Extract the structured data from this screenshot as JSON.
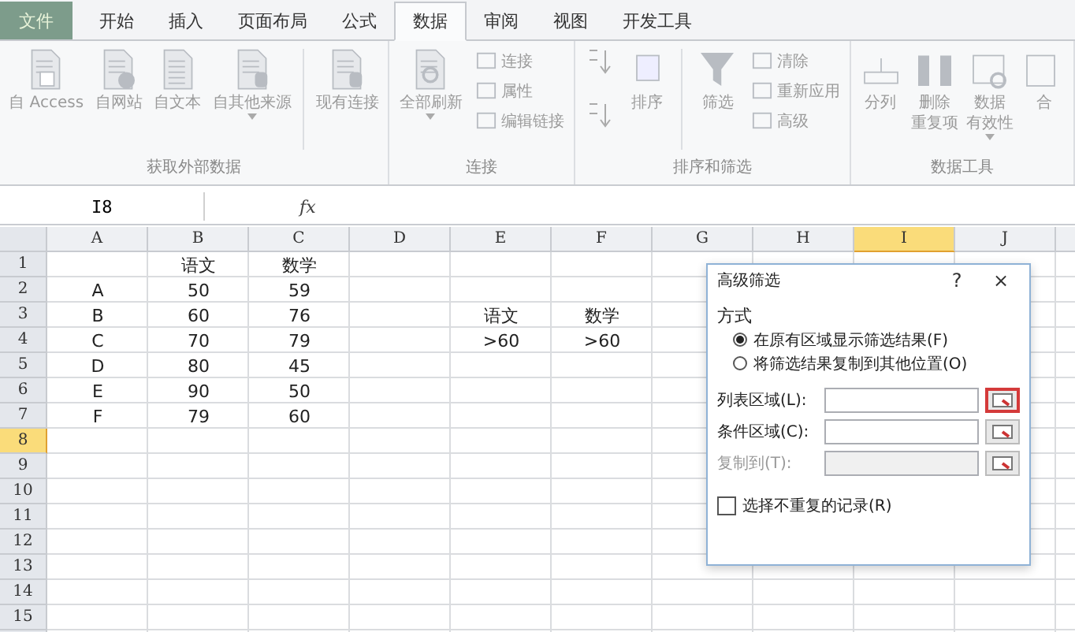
{
  "tabs": [
    {
      "label": "文件",
      "kind": "file",
      "selected": false
    },
    {
      "label": "开始",
      "kind": "tab",
      "selected": false
    },
    {
      "label": "插入",
      "kind": "tab",
      "selected": false
    },
    {
      "label": "页面布局",
      "kind": "tab",
      "selected": false
    },
    {
      "label": "公式",
      "kind": "tab",
      "selected": false
    },
    {
      "label": "数据",
      "kind": "tab",
      "selected": true
    },
    {
      "label": "审阅",
      "kind": "tab",
      "selected": false
    },
    {
      "label": "视图",
      "kind": "tab",
      "selected": false
    },
    {
      "label": "开发工具",
      "kind": "tab",
      "selected": false
    }
  ],
  "ribbon": {
    "disabled": true,
    "groups": [
      {
        "label": "获取外部数据",
        "items": [
          {
            "kind": "large",
            "lines": [
              "自 Access"
            ]
          },
          {
            "kind": "large",
            "lines": [
              "自网站"
            ]
          },
          {
            "kind": "large",
            "lines": [
              "自文本"
            ]
          },
          {
            "kind": "large",
            "lines": [
              "自其他来源"
            ],
            "dropdown": true
          },
          {
            "kind": "separator"
          },
          {
            "kind": "large",
            "lines": [
              "现有连接"
            ]
          }
        ]
      },
      {
        "label": "连接",
        "items": [
          {
            "kind": "large",
            "lines": [
              "全部刷新"
            ],
            "dropdown": true
          },
          {
            "kind": "stack",
            "buttons": [
              {
                "label": "连接"
              },
              {
                "label": "属性"
              },
              {
                "label": "编辑链接"
              }
            ]
          }
        ]
      },
      {
        "label": "排序和筛选",
        "items": [
          {
            "kind": "sortpair"
          },
          {
            "kind": "large",
            "lines": [
              "排序"
            ]
          },
          {
            "kind": "separator"
          },
          {
            "kind": "large",
            "lines": [
              "筛选"
            ]
          },
          {
            "kind": "stack",
            "buttons": [
              {
                "label": "清除"
              },
              {
                "label": "重新应用"
              },
              {
                "label": "高级"
              }
            ]
          }
        ]
      },
      {
        "label": "数据工具",
        "items": [
          {
            "kind": "large",
            "lines": [
              "分列"
            ]
          },
          {
            "kind": "large",
            "lines": [
              "删除",
              "重复项"
            ]
          },
          {
            "kind": "large",
            "lines": [
              "数据",
              "有效性"
            ],
            "dropdown": true
          },
          {
            "kind": "large",
            "lines": [
              "合"
            ]
          }
        ]
      }
    ]
  },
  "formula_bar": {
    "name_box": "I8",
    "function_label": "fx"
  },
  "columns": [
    {
      "label": "A",
      "selected": false
    },
    {
      "label": "B",
      "selected": false
    },
    {
      "label": "C",
      "selected": false
    },
    {
      "label": "D",
      "selected": false
    },
    {
      "label": "E",
      "selected": false
    },
    {
      "label": "F",
      "selected": false
    },
    {
      "label": "G",
      "selected": false
    },
    {
      "label": "H",
      "selected": false
    },
    {
      "label": "I",
      "selected": true
    },
    {
      "label": "J",
      "selected": false
    }
  ],
  "rows": [
    {
      "label": "1",
      "selected": false,
      "cells": [
        null,
        "语文",
        "数学",
        null,
        null,
        null,
        null,
        null,
        null,
        null
      ]
    },
    {
      "label": "2",
      "selected": false,
      "cells": [
        "A",
        "50",
        "59",
        null,
        null,
        null,
        null,
        null,
        null,
        null
      ]
    },
    {
      "label": "3",
      "selected": false,
      "cells": [
        "B",
        "60",
        "76",
        null,
        "语文",
        "数学",
        null,
        null,
        null,
        null
      ]
    },
    {
      "label": "4",
      "selected": false,
      "cells": [
        "C",
        "70",
        "79",
        null,
        ">60",
        ">60",
        null,
        null,
        null,
        null
      ]
    },
    {
      "label": "5",
      "selected": false,
      "cells": [
        "D",
        "80",
        "45",
        null,
        null,
        null,
        null,
        null,
        null,
        null
      ]
    },
    {
      "label": "6",
      "selected": false,
      "cells": [
        "E",
        "90",
        "50",
        null,
        null,
        null,
        null,
        null,
        null,
        null
      ]
    },
    {
      "label": "7",
      "selected": false,
      "cells": [
        "F",
        "79",
        "60",
        null,
        null,
        null,
        null,
        null,
        null,
        null
      ]
    },
    {
      "label": "8",
      "selected": true,
      "cells": [
        null,
        null,
        null,
        null,
        null,
        null,
        null,
        null,
        null,
        null
      ]
    },
    {
      "label": "9",
      "selected": false,
      "cells": [
        null,
        null,
        null,
        null,
        null,
        null,
        null,
        null,
        null,
        null
      ]
    },
    {
      "label": "10",
      "selected": false,
      "cells": [
        null,
        null,
        null,
        null,
        null,
        null,
        null,
        null,
        null,
        null
      ]
    },
    {
      "label": "11",
      "selected": false,
      "cells": [
        null,
        null,
        null,
        null,
        null,
        null,
        null,
        null,
        null,
        null
      ]
    },
    {
      "label": "12",
      "selected": false,
      "cells": [
        null,
        null,
        null,
        null,
        null,
        null,
        null,
        null,
        null,
        null
      ]
    },
    {
      "label": "13",
      "selected": false,
      "cells": [
        null,
        null,
        null,
        null,
        null,
        null,
        null,
        null,
        null,
        null
      ]
    },
    {
      "label": "14",
      "selected": false,
      "cells": [
        null,
        null,
        null,
        null,
        null,
        null,
        null,
        null,
        null,
        null
      ]
    },
    {
      "label": "15",
      "selected": false,
      "cells": [
        null,
        null,
        null,
        null,
        null,
        null,
        null,
        null,
        null,
        null
      ]
    }
  ],
  "dialog": {
    "title": "高级筛选",
    "help": "?",
    "close": "×",
    "section": "方式",
    "radios": [
      {
        "label": "在原有区域显示筛选结果(F)",
        "selected": true
      },
      {
        "label": "将筛选结果复制到其他位置(O)",
        "selected": false
      }
    ],
    "fields": [
      {
        "label": "列表区域(L):",
        "disabled": false,
        "highlighted": true
      },
      {
        "label": "条件区域(C):",
        "disabled": false,
        "highlighted": false
      },
      {
        "label": "复制到(T):",
        "disabled": true,
        "highlighted": false
      }
    ],
    "checkbox": {
      "label": "选择不重复的记录(R)",
      "checked": false
    }
  }
}
